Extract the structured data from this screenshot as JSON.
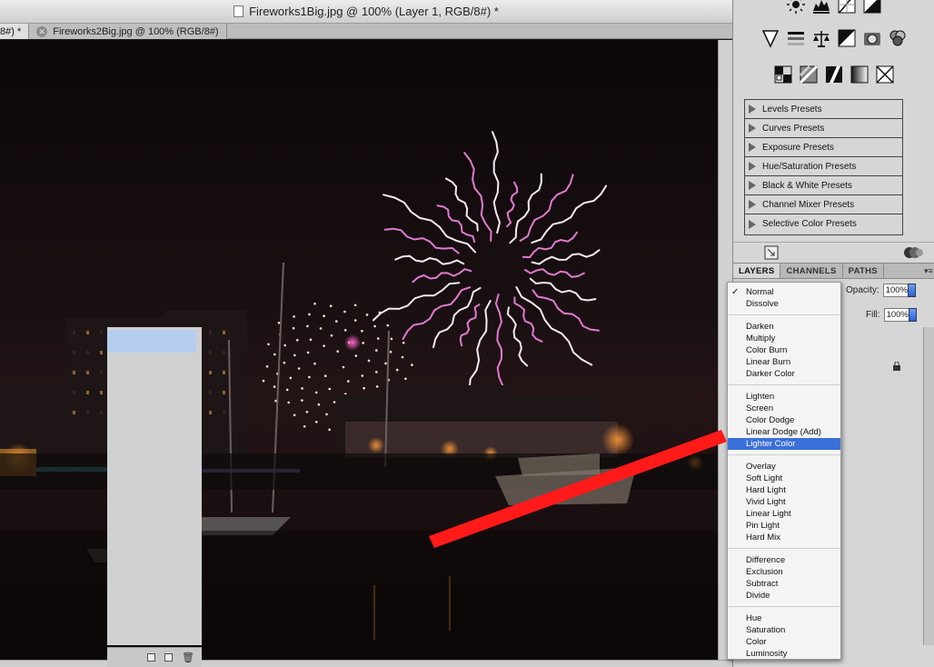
{
  "window": {
    "title": "Fireworks1Big.jpg @ 100% (Layer 1, RGB/8#) *"
  },
  "tabs": [
    {
      "label": "8#) *",
      "state": "active"
    },
    {
      "label": "Fireworks2Big.jpg @ 100% (RGB/8#)",
      "state": "inactive"
    }
  ],
  "adjustments": {
    "row1_icons": [
      "brightness-contrast-icon",
      "levels-icon",
      "curves-icon",
      "exposure-icon"
    ],
    "row2_icons": [
      "vibrance-icon",
      "hue-saturation-icon",
      "color-balance-icon",
      "black-white-icon",
      "photo-filter-icon",
      "channel-mixer-icon"
    ],
    "row3_icons": [
      "invert-icon",
      "posterize-icon",
      "threshold-icon",
      "gradient-map-icon",
      "selective-color-icon"
    ],
    "presets": [
      "Levels Presets",
      "Curves Presets",
      "Exposure Presets",
      "Hue/Saturation Presets",
      "Black & White Presets",
      "Channel Mixer Presets",
      "Selective Color Presets"
    ]
  },
  "panel_tabs": [
    "LAYERS",
    "CHANNELS",
    "PATHS"
  ],
  "layers": {
    "opacity_label": "Opacity:",
    "opacity_value": "100%",
    "fill_label": "Fill:",
    "fill_value": "100%"
  },
  "blend_menu": {
    "selected": "Normal",
    "highlighted": "Lighter Color",
    "groups": [
      [
        "Normal",
        "Dissolve"
      ],
      [
        "Darken",
        "Multiply",
        "Color Burn",
        "Linear Burn",
        "Darker Color"
      ],
      [
        "Lighten",
        "Screen",
        "Color Dodge",
        "Linear Dodge (Add)",
        "Lighter Color"
      ],
      [
        "Overlay",
        "Soft Light",
        "Hard Light",
        "Vivid Light",
        "Linear Light",
        "Pin Light",
        "Hard Mix"
      ],
      [
        "Difference",
        "Exclusion",
        "Subtract",
        "Divide"
      ],
      [
        "Hue",
        "Saturation",
        "Color",
        "Luminosity"
      ]
    ]
  },
  "colors": {
    "highlight": "#3a6fd8",
    "arrow": "#ff1a1a",
    "selected_layer": "#b7cdf0"
  }
}
